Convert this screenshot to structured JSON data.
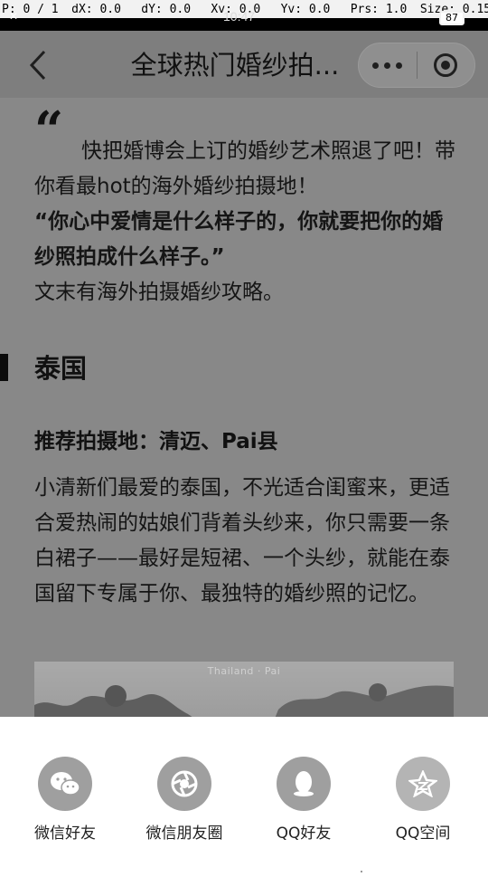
{
  "debug_overlay": {
    "items": [
      "P: 0 / 1",
      "dX: 0.0",
      "dY: 0.0",
      "Xv: 0.0",
      "Yv: 0.0",
      "Prs: 1.0",
      "Size: 0.15"
    ]
  },
  "status_bar": {
    "time": "10:47",
    "battery": "87"
  },
  "navbar": {
    "title": "全球热门婚纱拍..."
  },
  "article": {
    "quote_mark": "“",
    "intro_line1": "快把婚博会上订的婚纱艺术照退了吧！带你看最hot的海外婚纱拍摄地！",
    "intro_bold": "“你心中爱情是什么样子的，你就要把你的婚纱照拍成什么样子。”",
    "intro_line3": "文末有海外拍摄婚纱攻略。",
    "section_title": "泰国",
    "sub_title": "推荐拍摄地：清迈、Pai县",
    "paragraph": "小清新们最爱的泰国，不光适合闺蜜来，更适合爱热闹的姑娘们背着头纱来，你只需要一条白裙子——最好是短裙、一个头纱，就能在泰国留下专属于你、最独特的婚纱照的记忆。",
    "photo_caption": "Thailand · Pai"
  },
  "share_sheet": {
    "items": [
      {
        "label": "微信好友",
        "icon": "wechat-icon"
      },
      {
        "label": "微信朋友圈",
        "icon": "moments-icon"
      },
      {
        "label": "QQ好友",
        "icon": "qq-icon"
      },
      {
        "label": "QQ空间",
        "icon": "qzone-icon"
      }
    ]
  }
}
